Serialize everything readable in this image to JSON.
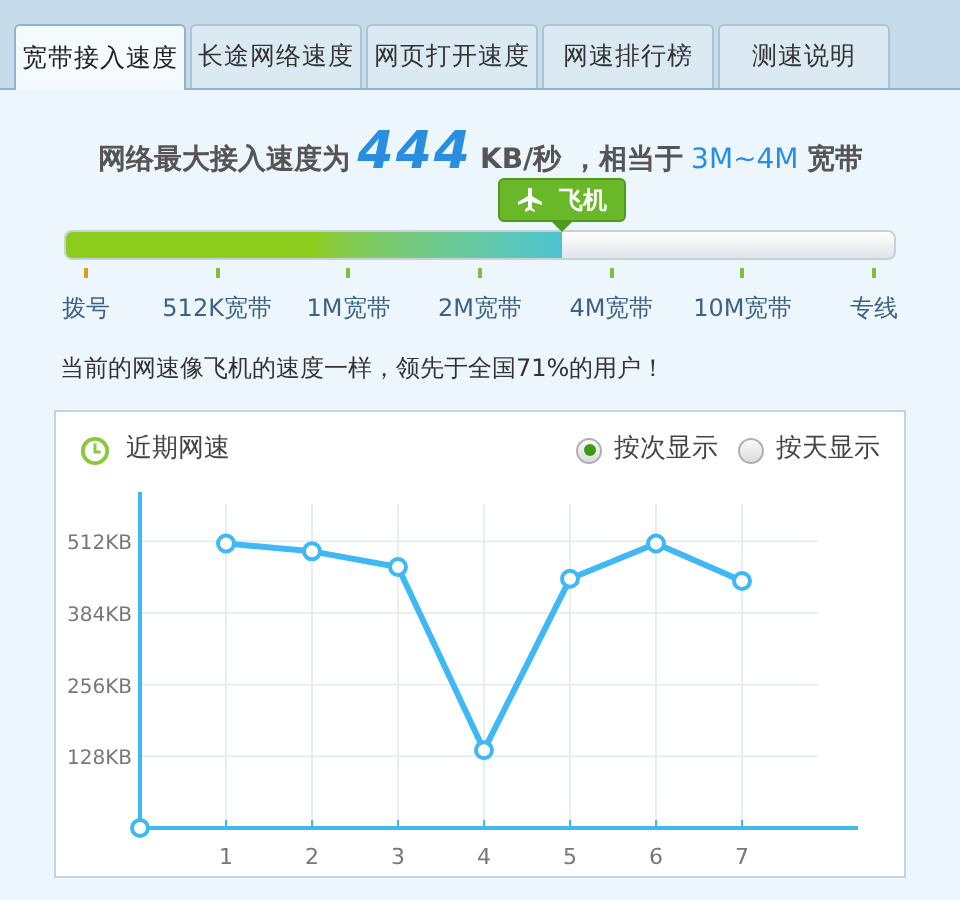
{
  "tabs": [
    {
      "label": "宽带接入速度",
      "selected": true
    },
    {
      "label": "长途网络速度",
      "selected": false
    },
    {
      "label": "网页打开速度",
      "selected": false
    },
    {
      "label": "网速排行榜",
      "selected": false
    },
    {
      "label": "测速说明",
      "selected": false
    }
  ],
  "headline": [
    {
      "kind": "text",
      "text": "网络最大接入速度为"
    },
    {
      "kind": "speed",
      "text": "444"
    },
    {
      "kind": "text",
      "text": "KB/秒 ，相当于"
    },
    {
      "kind": "range",
      "text": "3M~4M"
    },
    {
      "kind": "text",
      "text": "宽带"
    }
  ],
  "speed_meter": {
    "badge": "飞机",
    "level": 0.6,
    "labels": [
      {
        "text": "拨号",
        "color": "#d9a020"
      },
      {
        "text": "512K宽带",
        "color": "#7cc043"
      },
      {
        "text": "1M宽带",
        "color": "#7cc043"
      },
      {
        "text": "2M宽带",
        "color": "#7cc043"
      },
      {
        "text": "4M宽带",
        "color": "#7cc043"
      },
      {
        "text": "10M宽带",
        "color": "#7cc043"
      },
      {
        "text": "专线",
        "color": "#7cc043"
      }
    ]
  },
  "summary": "当前的网速像飞机的速度一样，领先于全国71%的用户！",
  "recent": {
    "title": "近期网速",
    "options": [
      {
        "label": "按次显示",
        "selected": true
      },
      {
        "label": "按天显示",
        "selected": false
      }
    ],
    "chart_data": {
      "type": "line",
      "grid": true,
      "categories": [
        "1",
        "2",
        "3",
        "4",
        "5",
        "6",
        "7"
      ],
      "ylim": [
        0,
        600
      ],
      "yticks": [
        {
          "value": 128,
          "label": "128KB"
        },
        {
          "value": 256,
          "label": "256KB"
        },
        {
          "value": 384,
          "label": "384KB"
        },
        {
          "value": 512,
          "label": "512KB"
        }
      ],
      "series": [
        {
          "color": "#3fb8f5",
          "marker": "circle",
          "values": [
            508,
            494,
            466,
            139,
            445,
            508,
            441
          ]
        }
      ]
    }
  }
}
